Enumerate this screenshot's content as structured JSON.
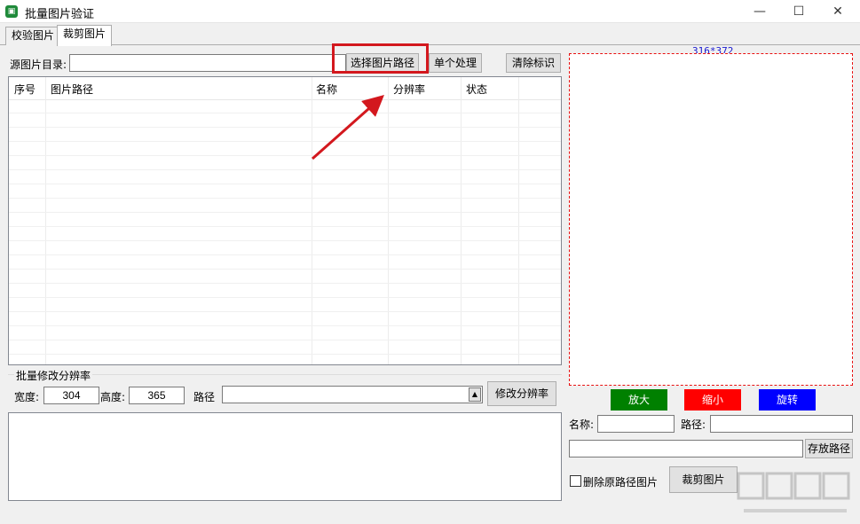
{
  "window": {
    "title": "批量图片验证",
    "minimize": "—",
    "maximize": "☐",
    "close": "✕"
  },
  "tabs": [
    {
      "label": "校验图片",
      "active": false
    },
    {
      "label": "裁剪图片",
      "active": true
    }
  ],
  "source": {
    "label": "源图片目录:",
    "value": "",
    "select_button": "选择图片路径",
    "single_button": "单个处理",
    "clear_button": "清除标识"
  },
  "grid": {
    "columns": [
      "序号",
      "图片路径",
      "名称",
      "分辨率",
      "状态"
    ],
    "rows": []
  },
  "batch": {
    "group_title": "批量修改分辨率",
    "width_label": "宽度:",
    "width_value": "304",
    "height_label": "高度:",
    "height_value": "365",
    "path_label": "路径",
    "path_value": "",
    "modify_button": "修改分辨率"
  },
  "preview": {
    "size_text": "316*372",
    "zoom_in": "放大",
    "zoom_out": "缩小",
    "rotate": "旋转",
    "name_label": "名称:",
    "name_value": "",
    "path_label": "路径:",
    "path_value": "",
    "save_path_value": "",
    "save_path_button": "存放路径",
    "delete_original_label": "删除原路径图片",
    "delete_original_checked": false,
    "crop_button": "裁剪图片"
  },
  "colors": {
    "zoom_in_bg": "#008000",
    "zoom_out_bg": "#ff0000",
    "rotate_bg": "#0000ff",
    "highlight": "#d3181e",
    "preview_border": "#e81010"
  }
}
